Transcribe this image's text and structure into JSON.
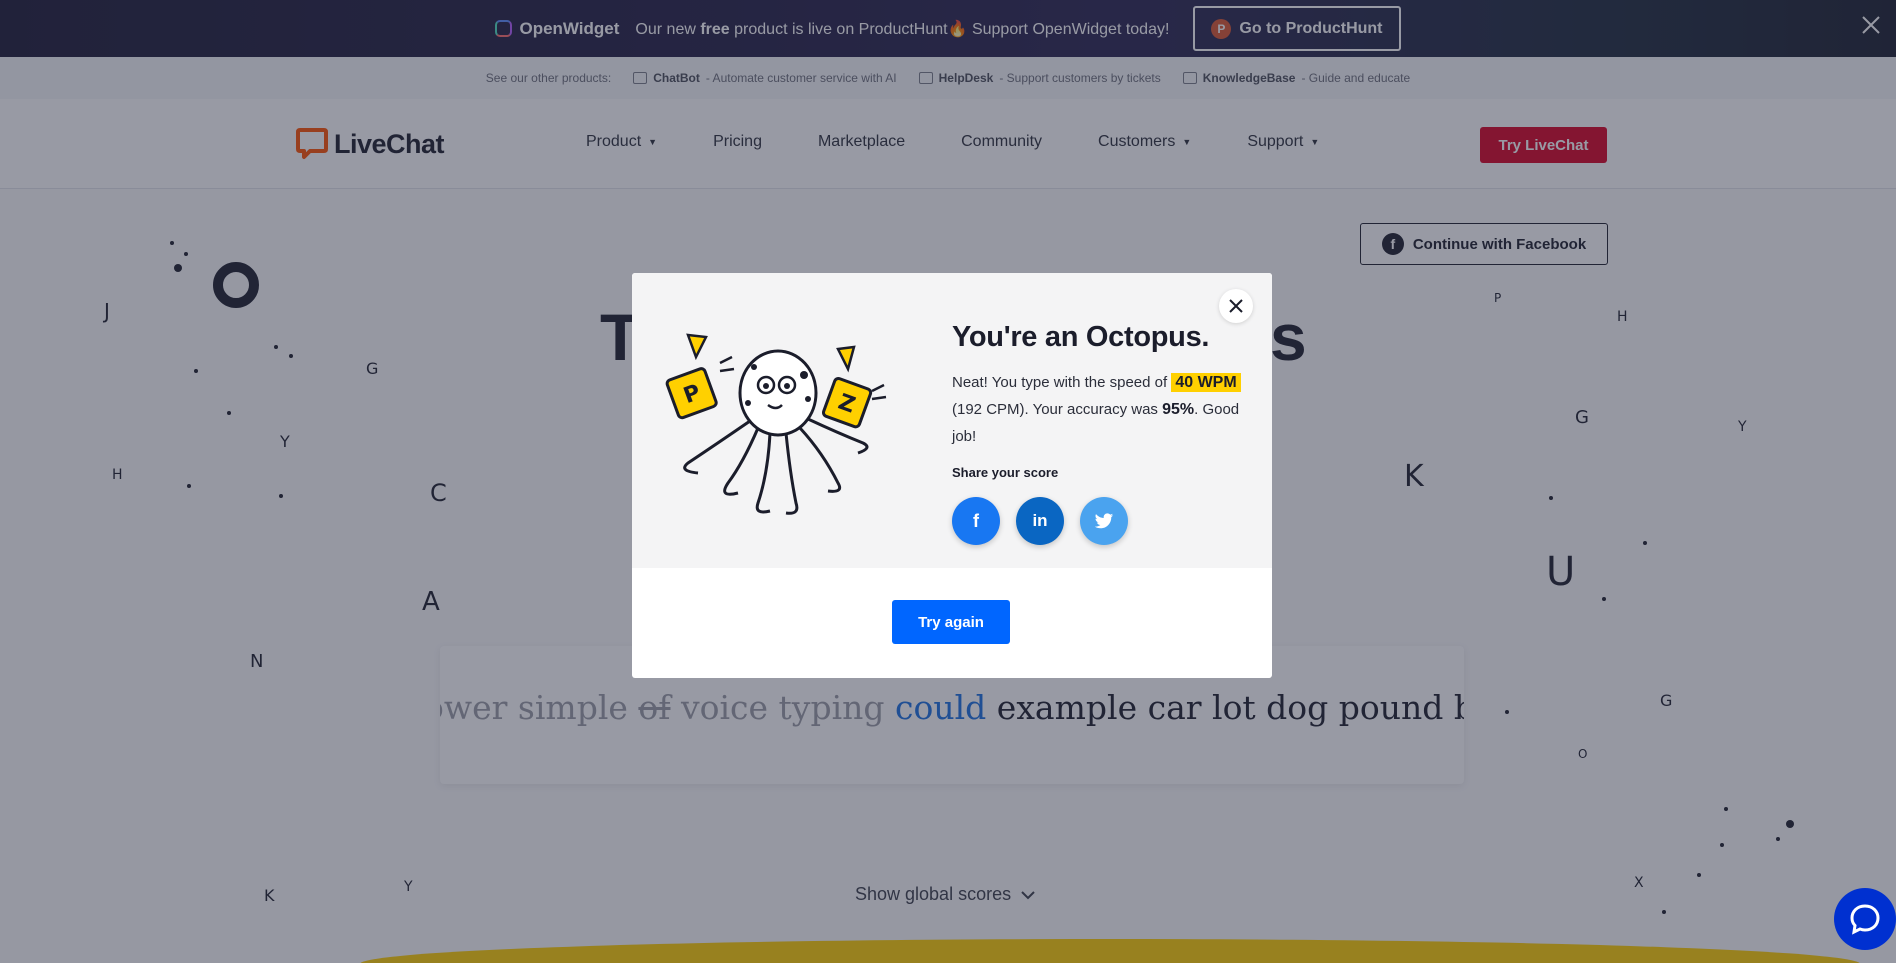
{
  "promo": {
    "brand": "OpenWidget",
    "message_pre": "Our new ",
    "message_bold": "free",
    "message_post": " product is live on ProductHunt🔥 Support OpenWidget today!",
    "cta": "Go to ProductHunt",
    "ph_letter": "P"
  },
  "products_bar": {
    "intro": "See our other products:",
    "items": [
      {
        "name": "ChatBot",
        "desc": " - Automate customer service with AI"
      },
      {
        "name": "HelpDesk",
        "desc": " - Support customers by tickets"
      },
      {
        "name": "KnowledgeBase",
        "desc": " - Guide and educate"
      }
    ]
  },
  "nav": {
    "logo": "LiveChat",
    "items": [
      {
        "label": "Product",
        "dropdown": true
      },
      {
        "label": "Pricing",
        "dropdown": false
      },
      {
        "label": "Marketplace",
        "dropdown": false
      },
      {
        "label": "Community",
        "dropdown": false
      },
      {
        "label": "Customers",
        "dropdown": true
      },
      {
        "label": "Support",
        "dropdown": true
      }
    ],
    "cta": "Try LiveChat"
  },
  "main": {
    "facebook_button": "Continue with Facebook",
    "title_left": "T",
    "title_right": "s",
    "typing": {
      "done_1": "ower simple ",
      "error_word": "of",
      "done_2": " voice typing ",
      "current_word": "could",
      "upcoming": " example car lot dog pound box u"
    },
    "show_scores": "Show global scores"
  },
  "modal": {
    "title": "You're an Octopus.",
    "text_1": "Neat! You type with the speed of ",
    "wpm": "40 WPM",
    "text_2": " (192 CPM). Your accuracy was ",
    "accuracy": "95%",
    "text_3": ". Good job!",
    "share_label": "Share your score",
    "share": {
      "facebook": "f",
      "linkedin": "in",
      "twitter": "twitter-icon"
    },
    "try_again": "Try again"
  },
  "colors": {
    "brand_red": "#d90023",
    "accent_blue": "#0066ff",
    "highlight_yellow": "#ffd000",
    "livechat_orange": "#ff5100"
  }
}
